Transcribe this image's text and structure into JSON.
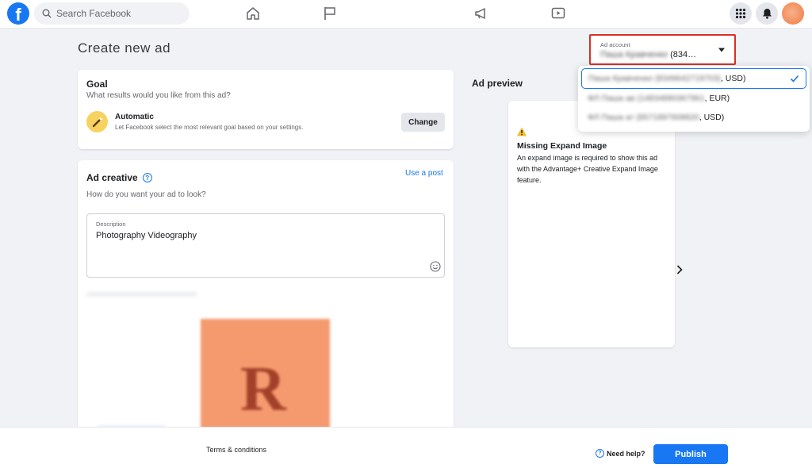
{
  "topbar": {
    "logo_letter": "f",
    "search_placeholder": "Search Facebook",
    "nav_icons": [
      "home-icon",
      "flag-icon",
      "megaphone-icon",
      "video-icon"
    ],
    "right_icons": [
      "apps-grid-icon",
      "bell-icon",
      "avatar"
    ]
  },
  "page": {
    "title": "Create new ad"
  },
  "goal": {
    "title": "Goal",
    "subtitle": "What results would you like from this ad?",
    "option_name": "Automatic",
    "option_desc": "Let Facebook select the most relevant goal based on your settings.",
    "change_label": "Change"
  },
  "creative": {
    "title": "Ad creative",
    "use_post_label": "Use a post",
    "subtitle": "How do you want your ad to look?",
    "description_label": "Description",
    "description_value": "Photography Videography",
    "thumbnail_letter": "R"
  },
  "preview": {
    "title": "Ad preview",
    "warning_title": "Missing Expand Image",
    "warning_body": "An expand image is required to show this ad with the Advantage+ Creative Expand Image feature."
  },
  "ad_account": {
    "label": "Ad account",
    "selected_name": "Паша Кравченко",
    "selected_suffix": "(834…",
    "options": [
      {
        "name": "Паша Кравченко (8349642719703)",
        "currency": ", USD)",
        "selected": true
      },
      {
        "name": "ФЛ Паша ав (14834880367961",
        "currency": ", EUR)",
        "selected": false
      },
      {
        "name": "ФЛ Паша ат (8571897608820",
        "currency": ", USD)",
        "selected": false
      }
    ]
  },
  "footer": {
    "terms_label": "Terms & conditions",
    "help_label": "Need help?",
    "publish_label": "Publish"
  },
  "colors": {
    "brand": "#1877f2",
    "highlight_border": "#d93025",
    "warning": "#f7b928"
  }
}
